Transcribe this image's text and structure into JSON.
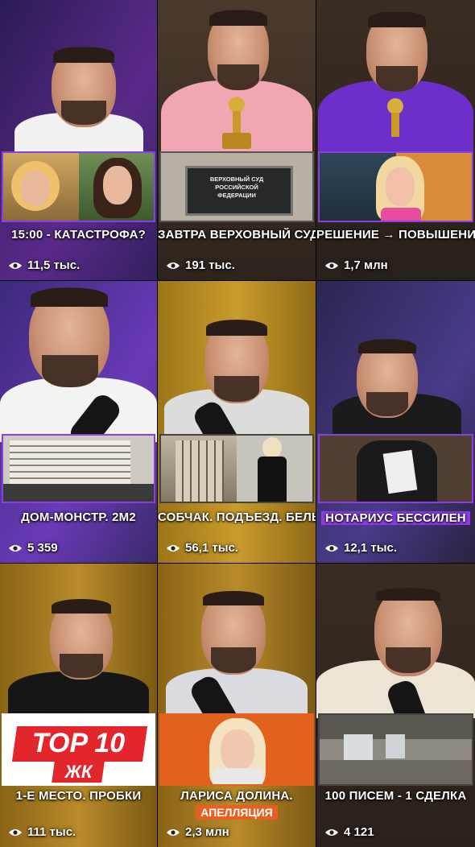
{
  "tiles": [
    {
      "caption": "15:00 - КАТАСТРОФА?",
      "views": "11,5 тыс."
    },
    {
      "caption": "ЗАВТРА ВЕРХОВНЫЙ СУД",
      "views": "191 тыс.",
      "court_sign": "ВЕРХОВНЫЙ СУД РОССИЙСКОЙ ФЕДЕРАЦИИ"
    },
    {
      "caption": "РЕШЕНИЕ → ПОВЫШЕНИЕ",
      "views": "1,7 млн"
    },
    {
      "caption": "ДОМ-МОНСТР. 2М2",
      "views": "5 359"
    },
    {
      "caption": "СОБЧАК. ПОДЪЕЗД. БЕЛЬЁ",
      "views": "56,1 тыс."
    },
    {
      "caption": "НОТАРИУС БЕССИЛЕН",
      "views": "12,1 тыс."
    },
    {
      "caption": "1-Е МЕСТО. ПРОБКИ",
      "views": "111 тыс.",
      "badge_top": "TOP 10",
      "badge_bottom": "ЖК"
    },
    {
      "caption": "ЛАРИСА ДОЛИНА.",
      "subcaption": "АПЕЛЛЯЦИЯ",
      "views": "2,3 млн"
    },
    {
      "caption": "100 ПИСЕМ - 1 СДЕЛКА",
      "views": "4 121"
    }
  ],
  "icons": {
    "views": "eye-icon"
  },
  "colors": {
    "accent_purple": "#8b3fe0",
    "accent_orange": "#e85f22",
    "badge_red": "#e3262c"
  }
}
